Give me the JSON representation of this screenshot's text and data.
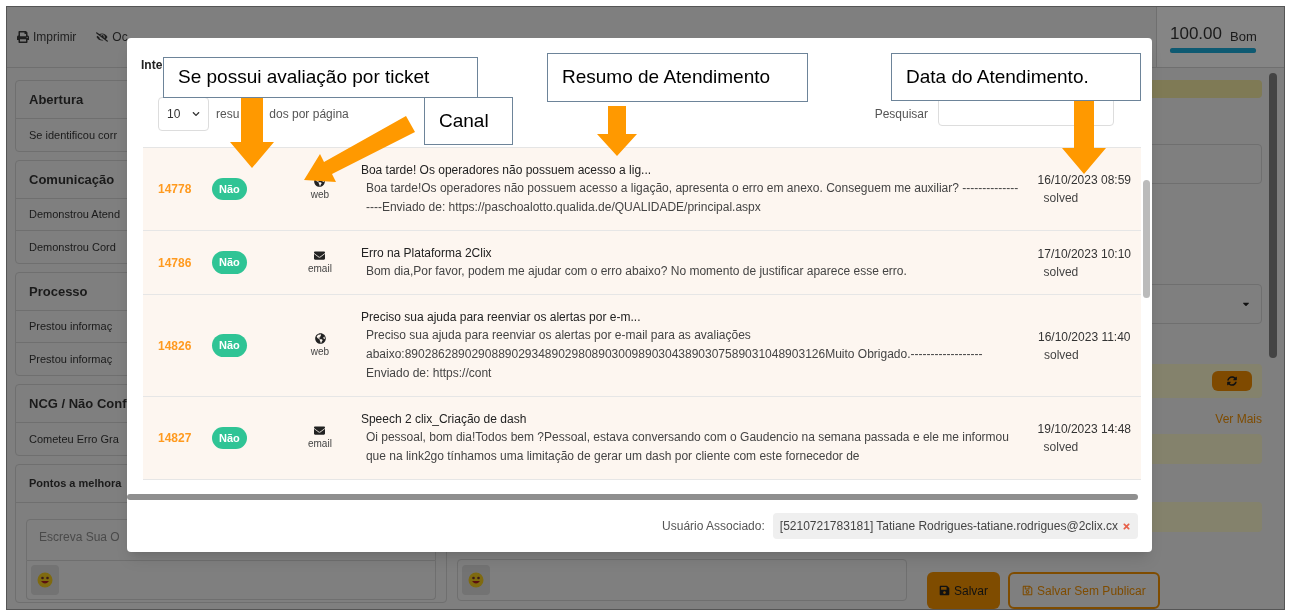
{
  "toolbar": [
    {
      "label": "Imprimir"
    },
    {
      "label": "Oc"
    }
  ],
  "score": {
    "value": "100.00",
    "rating": "Bom",
    "level": 1
  },
  "sections": [
    {
      "title": "Abertura",
      "items": [
        "Se identificou corr"
      ]
    },
    {
      "title": "Comunicação",
      "items": [
        "Demonstrou Atend",
        "Demonstrou Cord"
      ]
    },
    {
      "title": "Processo",
      "items": [
        "Prestou informaç",
        "Prestou informaç"
      ]
    },
    {
      "title": "NCG / Não Conf",
      "items": [
        "Cometeu Erro Gra"
      ]
    }
  ],
  "improvement": {
    "title": "Pontos a melhora",
    "placeholder": "Escreva Sua O"
  },
  "side": {
    "link": "Ver Mais",
    "buttons": [
      {
        "label": "Salvar",
        "kind": "primary"
      },
      {
        "label": "Salvar Sem Publicar",
        "kind": "outline"
      }
    ]
  },
  "modal": {
    "title": "Inte",
    "page_size": "10",
    "page_size_label": [
      "resu",
      "dos por página"
    ],
    "search_label": "Pesquisar",
    "rows": [
      {
        "id": "14778",
        "evaluated": "Não",
        "channel": {
          "kind": "web",
          "label": "web"
        },
        "subject": "Boa tarde! Os operadores não possuem acesso a lig...",
        "body": "Boa tarde!Os operadores não possuem acesso a ligação, apresenta o erro em anexo. Conseguem me auxiliar? ------------------Enviado de: https://paschoalotto.qualida.de/QUALIDADE/principal.aspx",
        "date": "16/10/2023 08:59",
        "status": "solved"
      },
      {
        "id": "14786",
        "evaluated": "Não",
        "channel": {
          "kind": "email",
          "label": "email"
        },
        "subject": "Erro na Plataforma 2Clix",
        "body": "Bom dia,Por favor, podem me ajudar com o erro abaixo? No momento de justificar aparece esse erro.",
        "date": "17/10/2023 10:10",
        "status": "solved"
      },
      {
        "id": "14826",
        "evaluated": "Não",
        "channel": {
          "kind": "web",
          "label": "web"
        },
        "subject": "Preciso sua ajuda para reenviar os alertas por e-m...",
        "body": "Preciso sua ajuda para reenviar os alertas por e-mail para as avaliações abaixo:890286289029088902934890298089030098903043890307589031048903126Muito Obrigado.------------------Enviado de: https://cont",
        "date": "16/10/2023 11:40",
        "status": "solved"
      },
      {
        "id": "14827",
        "evaluated": "Não",
        "channel": {
          "kind": "email",
          "label": "email"
        },
        "subject": "Speech 2 clix_Criação de dash",
        "body": "Oi pessoal, bom dia!Todos bem ?Pessoal, estava conversando com o Gaudencio na semana passada e ele me informou que na link2go tínhamos uma limitação de gerar um dash por cliente com este fornecedor de",
        "date": "19/10/2023 14:48",
        "status": "solved"
      }
    ],
    "associated_label": "Usuário Associado:",
    "associated_user": "[5210721783181] Tatiane Rodrigues-tatiane.rodrigues@2clix.cx"
  },
  "annotations": [
    {
      "text": "Se possui avaliação por ticket"
    },
    {
      "text": "Canal"
    },
    {
      "text": "Resumo de Atendimento"
    },
    {
      "text": "Data do Atendimento."
    }
  ]
}
